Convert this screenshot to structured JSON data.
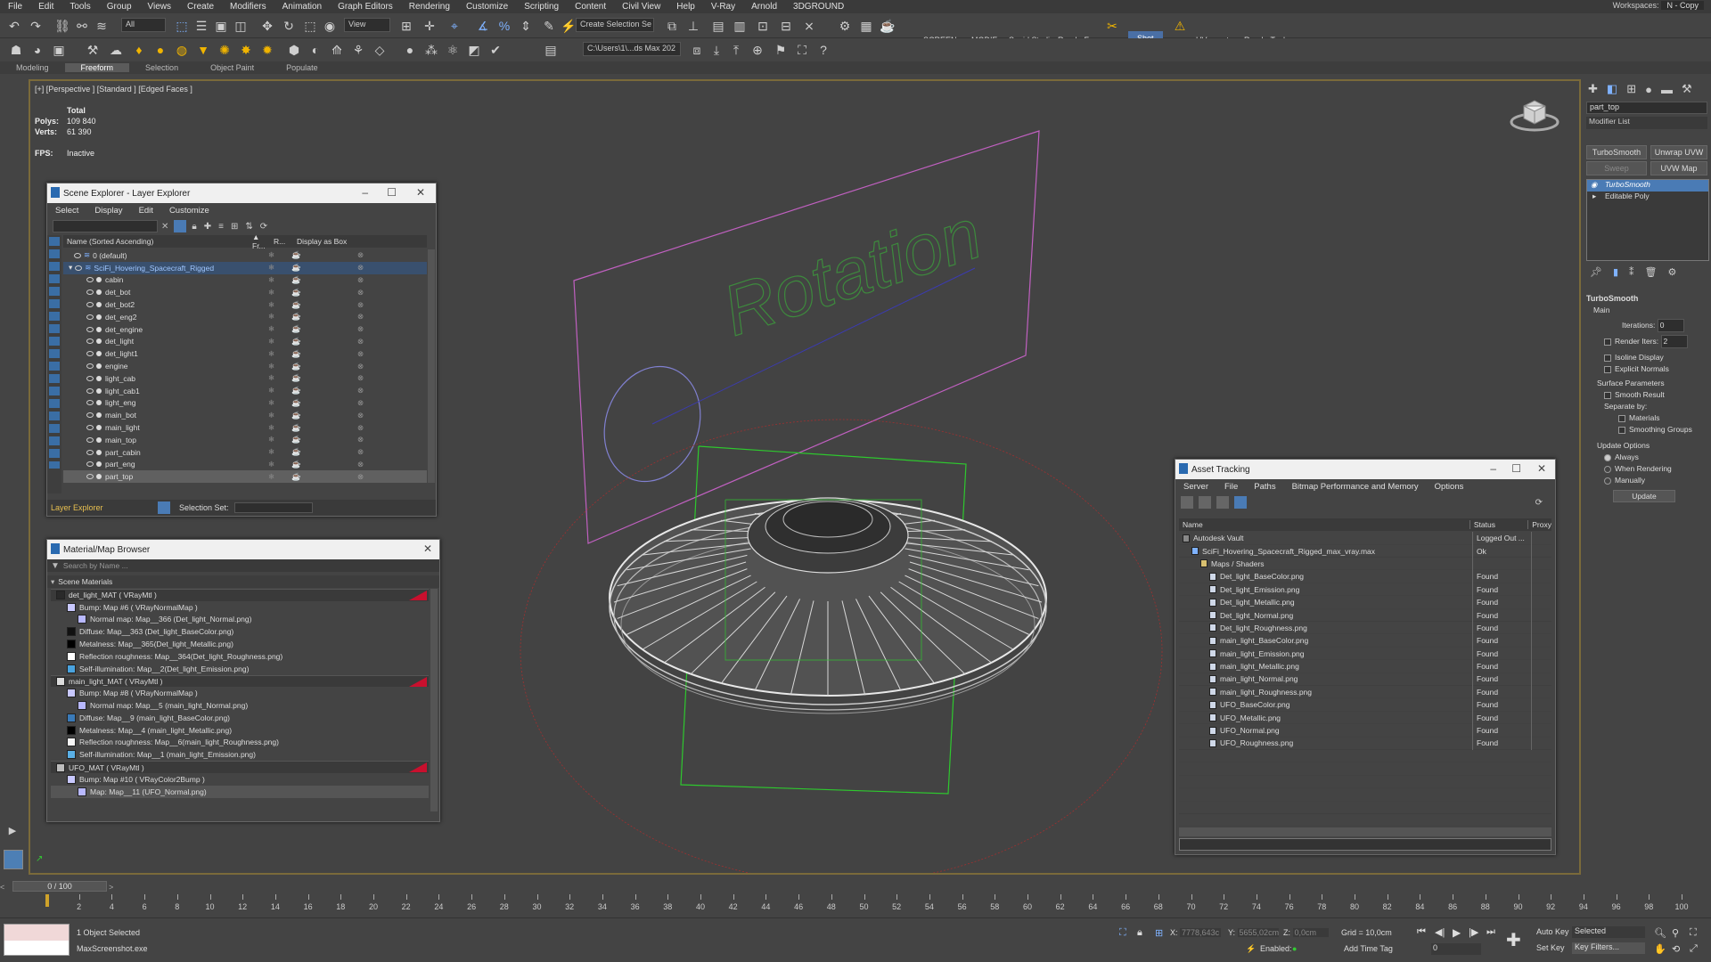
{
  "menu": [
    "File",
    "Edit",
    "Tools",
    "Group",
    "Views",
    "Create",
    "Modifiers",
    "Animation",
    "Graph Editors",
    "Rendering",
    "Customize",
    "Scripting",
    "Content",
    "Civil View",
    "Help",
    "V-Ray",
    "Arnold",
    "3DGROUND"
  ],
  "workspace": {
    "label": "Workspaces:",
    "value": "N - Copy"
  },
  "toolbar": {
    "filter_all": "All",
    "view_select": "View",
    "create_selection": "Create Selection Se",
    "screen": "SCREEN",
    "modif": "MODIF",
    "squid": "Squid Studio v",
    "renderfarm": "RenderFarm",
    "shot": "Shot",
    "uvexporter": "UVexporter",
    "rendertool": "RenderTool",
    "path": "C:\\Users\\1\\...ds Max 202"
  },
  "ribbon": [
    "Modeling",
    "Freeform",
    "Selection",
    "Object Paint",
    "Populate"
  ],
  "viewport": {
    "label": "[+] [Perspective ] [Standard ] [Edged Faces ]",
    "total": "Total",
    "polys_label": "Polys:",
    "polys": "109 840",
    "verts_label": "Verts:",
    "verts": "61 390",
    "fps_label": "FPS:",
    "fps": "Inactive",
    "rotation_text": "Rotation"
  },
  "scene_explorer": {
    "title": "Scene Explorer - Layer Explorer",
    "menu": [
      "Select",
      "Display",
      "Edit",
      "Customize"
    ],
    "col_name": "Name (Sorted Ascending)",
    "col_fr": "▲ Fr...",
    "col_r": "R...",
    "col_box": "Display as Box",
    "rows": [
      "0 (default)",
      "SciFi_Hovering_Spacecraft_Rigged",
      "cabin",
      "det_bot",
      "det_bot2",
      "det_eng2",
      "det_engine",
      "det_light",
      "det_light1",
      "engine",
      "light_cab",
      "light_cab1",
      "light_eng",
      "main_bot",
      "main_light",
      "main_top",
      "part_cabin",
      "part_eng",
      "part_top"
    ],
    "footer_layer": "Layer Explorer",
    "footer_selset": "Selection Set:"
  },
  "material_browser": {
    "title": "Material/Map Browser",
    "search": "Search by Name ...",
    "section": "Scene Materials",
    "rows": [
      {
        "text": "det_light_MAT  ( VRayMtl )",
        "level": 0,
        "swatch": "#2a2a2a",
        "tri": true
      },
      {
        "text": "Bump: Map #6  ( VRayNormalMap )",
        "level": 1,
        "swatch": "#c8c8ff"
      },
      {
        "text": "Normal map: Map__366 (Det_light_Normal.png)",
        "level": 2,
        "swatch": "#b8b8ff"
      },
      {
        "text": "Diffuse: Map__363 (Det_light_BaseColor.png)",
        "level": 1,
        "swatch": "#111111"
      },
      {
        "text": "Metalness: Map__365(Det_light_Metallic.png)",
        "level": 1,
        "swatch": "#000000"
      },
      {
        "text": "Reflection roughness: Map__364(Det_light_Roughness.png)",
        "level": 1,
        "swatch": "#ffffff"
      },
      {
        "text": "Self-illumination: Map__2(Det_light_Emission.png)",
        "level": 1,
        "swatch": "#4aa3df"
      },
      {
        "text": "main_light_MAT  ( VRayMtl )",
        "level": 0,
        "swatch": "#dcdcdc",
        "tri": true
      },
      {
        "text": "Bump: Map #8  ( VRayNormalMap )",
        "level": 1,
        "swatch": "#c8c8ff"
      },
      {
        "text": "Normal map: Map__5 (main_light_Normal.png)",
        "level": 2,
        "swatch": "#b8b8ff"
      },
      {
        "text": "Diffuse: Map__9 (main_light_BaseColor.png)",
        "level": 1,
        "swatch": "#3a7ab8"
      },
      {
        "text": "Metalness: Map__4 (main_light_Metallic.png)",
        "level": 1,
        "swatch": "#000000"
      },
      {
        "text": "Reflection roughness: Map__6(main_light_Roughness.png)",
        "level": 1,
        "swatch": "#f5f5f5"
      },
      {
        "text": "Self-illumination: Map__1 (main_light_Emission.png)",
        "level": 1,
        "swatch": "#5ab0e6"
      },
      {
        "text": "UFO_MAT  ( VRayMtl )",
        "level": 0,
        "swatch": "#bdbdbd",
        "tri": true
      },
      {
        "text": "Bump: Map #10  ( VRayColor2Bump )",
        "level": 1,
        "swatch": "#c8c8ff"
      },
      {
        "text": "Map: Map__11 (UFO_Normal.png)",
        "level": 2,
        "swatch": "#b8b8ff"
      }
    ]
  },
  "asset_tracking": {
    "title": "Asset Tracking",
    "menu": [
      "Server",
      "File",
      "Paths",
      "Bitmap Performance and Memory",
      "Options"
    ],
    "col_name": "Name",
    "col_status": "Status",
    "col_proxy": "Proxy",
    "rows": [
      {
        "name": "Autodesk Vault",
        "status": "Logged Out ...",
        "level": 0
      },
      {
        "name": "SciFi_Hovering_Spacecraft_Rigged_max_vray.max",
        "status": "Ok",
        "level": 1
      },
      {
        "name": "Maps / Shaders",
        "status": "",
        "level": 2
      },
      {
        "name": "Det_light_BaseColor.png",
        "status": "Found",
        "level": 3
      },
      {
        "name": "Det_light_Emission.png",
        "status": "Found",
        "level": 3
      },
      {
        "name": "Det_light_Metallic.png",
        "status": "Found",
        "level": 3
      },
      {
        "name": "Det_light_Normal.png",
        "status": "Found",
        "level": 3
      },
      {
        "name": "Det_light_Roughness.png",
        "status": "Found",
        "level": 3
      },
      {
        "name": "main_light_BaseColor.png",
        "status": "Found",
        "level": 3
      },
      {
        "name": "main_light_Emission.png",
        "status": "Found",
        "level": 3
      },
      {
        "name": "main_light_Metallic.png",
        "status": "Found",
        "level": 3
      },
      {
        "name": "main_light_Normal.png",
        "status": "Found",
        "level": 3
      },
      {
        "name": "main_light_Roughness.png",
        "status": "Found",
        "level": 3
      },
      {
        "name": "UFO_BaseColor.png",
        "status": "Found",
        "level": 3
      },
      {
        "name": "UFO_Metallic.png",
        "status": "Found",
        "level": 3
      },
      {
        "name": "UFO_Normal.png",
        "status": "Found",
        "level": 3
      },
      {
        "name": "UFO_Roughness.png",
        "status": "Found",
        "level": 3
      }
    ]
  },
  "command_panel": {
    "object_name": "part_top",
    "modifier_list": "Modifier List",
    "btn_turbosmooth": "TurboSmooth",
    "btn_unwrap": "Unwrap UVW",
    "btn_sweep": "Sweep",
    "btn_uvwmap": "UVW Map",
    "stack": [
      "TurboSmooth",
      "Editable Poly"
    ],
    "rollout": "TurboSmooth",
    "main": "Main",
    "iterations_label": "Iterations:",
    "iterations": "0",
    "render_iters_label": "Render Iters:",
    "render_iters": "2",
    "isoline": "Isoline Display",
    "explicit": "Explicit Normals",
    "surface": "Surface Parameters",
    "smooth": "Smooth Result",
    "separate": "Separate by:",
    "materials": "Materials",
    "smoothing": "Smoothing Groups",
    "update_options": "Update Options",
    "always": "Always",
    "when_rendering": "When Rendering",
    "manually": "Manually",
    "update_btn": "Update"
  },
  "timeline": {
    "frame": "0 / 100",
    "ticks": [
      "0",
      "2",
      "4",
      "6",
      "8",
      "10",
      "12",
      "14",
      "16",
      "18",
      "20",
      "22",
      "24",
      "26",
      "28",
      "30",
      "32",
      "34",
      "36",
      "38",
      "40",
      "42",
      "44",
      "46",
      "48",
      "50",
      "52",
      "54",
      "56",
      "58",
      "60",
      "62",
      "64",
      "66",
      "68",
      "70",
      "72",
      "74",
      "76",
      "78",
      "80",
      "82",
      "84",
      "86",
      "88",
      "90",
      "92",
      "94",
      "96",
      "98",
      "100"
    ]
  },
  "status": {
    "selected": "1 Object Selected",
    "script": "MaxScreenshot.exe",
    "x_label": "X:",
    "x": "7778,643c",
    "y_label": "Y:",
    "y": "5655,02cm",
    "z_label": "Z:",
    "z": "0,0cm",
    "grid": "Grid = 10,0cm",
    "enabled": "Enabled:",
    "add_time_tag": "Add Time Tag",
    "autokey": "Auto Key",
    "setkey": "Set Key",
    "selected_dd": "Selected",
    "keyfilters": "Key Filters...",
    "frame_field": "0"
  }
}
